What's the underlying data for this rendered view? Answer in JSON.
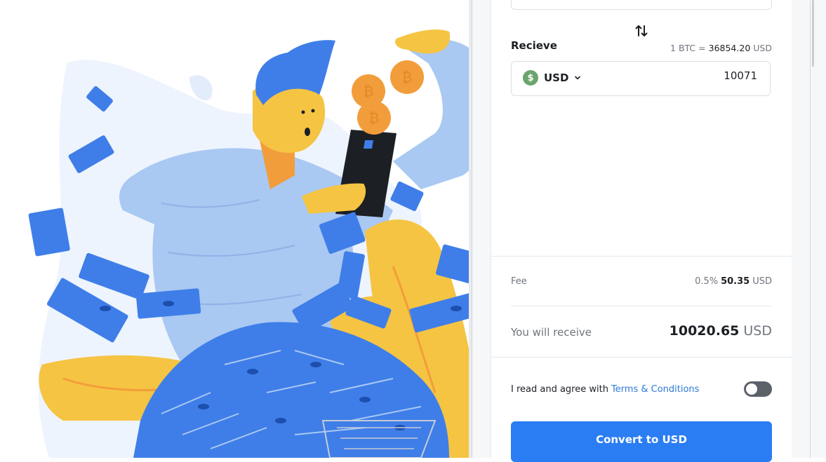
{
  "exchange": {
    "receive_label": "Recieve",
    "rate": {
      "prefix": "1 BTC =",
      "value": "36854.20",
      "currency": "USD"
    },
    "currency": {
      "symbol": "$",
      "code": "USD",
      "icon": "chevron-down-icon"
    },
    "amount": "10071",
    "swap_icon": "swap-vertical-icon"
  },
  "fee": {
    "label": "Fee",
    "percent": "0.5%",
    "amount": "50.35",
    "currency": "USD"
  },
  "summary": {
    "label": "You will receive",
    "amount": "10020.65",
    "currency": "USD"
  },
  "agreement": {
    "text": "I read and agree with",
    "link": "Terms & Conditions",
    "toggle_on": false
  },
  "actions": {
    "convert_label": "Convert to USD"
  },
  "colors": {
    "primary": "#2a7df2",
    "link": "#2d7ad6",
    "usd_coin": "#6aa56e",
    "illustration_blue": "#3f7ee8",
    "illustration_light_blue": "#a9c8f2",
    "illustration_yellow": "#f5c443",
    "illustration_orange": "#f29d3b"
  }
}
